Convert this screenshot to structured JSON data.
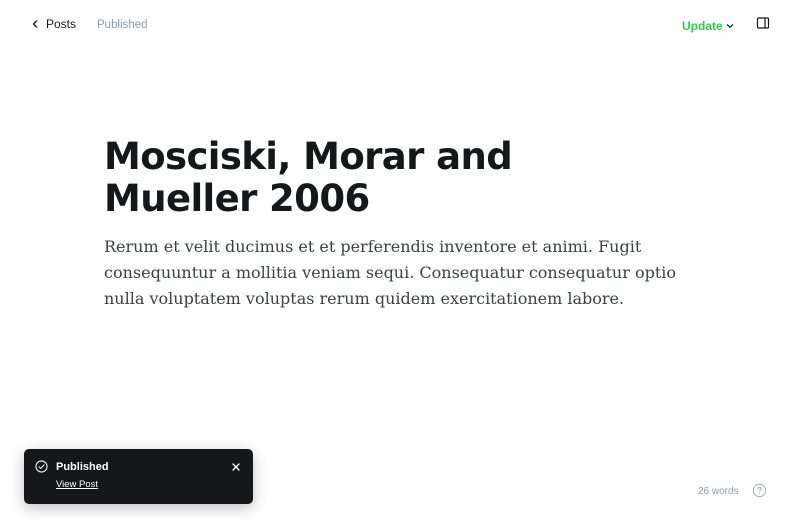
{
  "header": {
    "back_label": "Posts",
    "status": "Published",
    "update_label": "Update",
    "accent_color": "#30cf43"
  },
  "post": {
    "title": "Mosciski, Morar and Mueller 2006",
    "body": "Rerum et velit ducimus et et perferendis inventore et animi. Fugit consequuntur a mollitia veniam sequi. Consequatur consequatur optio nulla voluptatem voluptas rerum quidem exercitationem labore."
  },
  "toast": {
    "title": "Published",
    "link_label": "View Post",
    "icon": "check-circle-icon"
  },
  "footer": {
    "word_count": "26 words",
    "help_icon": "help-icon"
  }
}
